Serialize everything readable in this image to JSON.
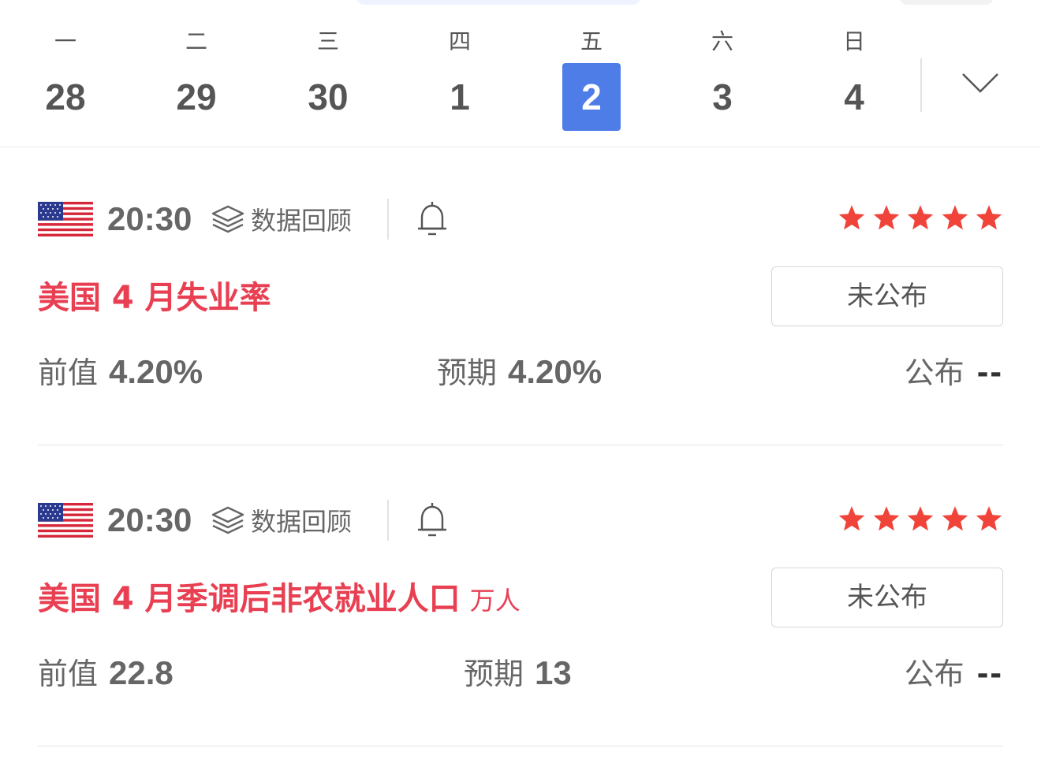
{
  "week": {
    "days": [
      {
        "weekday": "一",
        "date": "28"
      },
      {
        "weekday": "二",
        "date": "29"
      },
      {
        "weekday": "三",
        "date": "30"
      },
      {
        "weekday": "四",
        "date": "1"
      },
      {
        "weekday": "五",
        "date": "2"
      },
      {
        "weekday": "六",
        "date": "3"
      },
      {
        "weekday": "日",
        "date": "4"
      }
    ],
    "selected_index": 4,
    "expand_icon": "chevron-down-icon",
    "accent_color": "#4f7de8"
  },
  "events": [
    {
      "country": "United States",
      "flag_icon": "us-flag-icon",
      "time": "20:30",
      "review_label": "数据回顾",
      "importance_stars": 5,
      "title": "美国 4 月失业率",
      "unit": "",
      "status": "未公布",
      "previous_label": "前值",
      "previous_value": "4.20%",
      "forecast_label": "预期",
      "forecast_value": "4.20%",
      "actual_label": "公布",
      "actual_value": "--"
    },
    {
      "country": "United States",
      "flag_icon": "us-flag-icon",
      "time": "20:30",
      "review_label": "数据回顾",
      "importance_stars": 5,
      "title": "美国 4 月季调后非农就业人口",
      "unit": "万人",
      "status": "未公布",
      "previous_label": "前值",
      "previous_value": "22.8",
      "forecast_label": "预期",
      "forecast_value": "13",
      "actual_label": "公布",
      "actual_value": "--"
    }
  ],
  "colors": {
    "title": "#e84052",
    "star": "#f0443a",
    "text": "#666666"
  }
}
